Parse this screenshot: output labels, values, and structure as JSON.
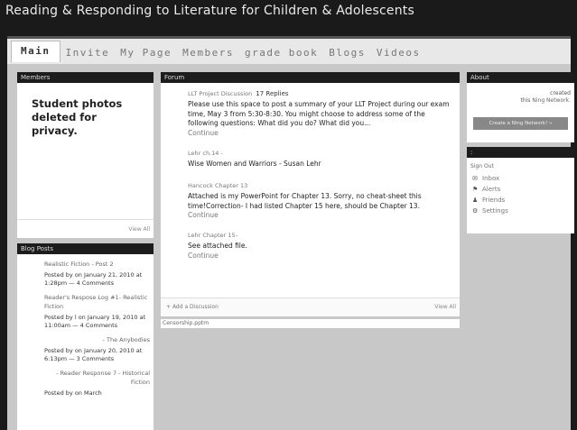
{
  "site": {
    "title": "Reading & Responding to Literature for Children & Adolescents"
  },
  "nav": {
    "tabs": [
      {
        "label": "Main",
        "active": true
      },
      {
        "label": "Invite"
      },
      {
        "label": "My Page"
      },
      {
        "label": "Members"
      },
      {
        "label": "grade book"
      },
      {
        "label": "Blogs"
      },
      {
        "label": "Videos"
      }
    ]
  },
  "members": {
    "header": "Members",
    "note": "Student photos deleted for privacy.",
    "view_all": "View All"
  },
  "blog_posts": {
    "header": "Blog Posts",
    "posts": [
      {
        "title": "Realistic Fiction - Post 2",
        "meta": "Posted by on January 21, 2010 at 1:28pm — 4 Comments"
      },
      {
        "title": "Reader's Respose Log #1- Realistic Fiction",
        "meta": "Posted by l on January 19, 2010 at 11:00am — 4 Comments"
      },
      {
        "title": "- The Anybodies",
        "meta": "Posted by on January 20, 2010 at 6:13pm — 3 Comments"
      },
      {
        "title": "- Reader Response 7 - Historical Fiction",
        "meta": "Posted by on March"
      }
    ]
  },
  "forum": {
    "header": "Forum",
    "topics": [
      {
        "title": "LLT Project Discussion",
        "replies": "17 Replies",
        "body": "Please use this space to post a summary of your LLT Project during our exam time, May 3 from 5:30-8:30. You might choose to address some of the following questions: What did you do? What did you...",
        "continue": "Continue"
      },
      {
        "title": "Lehr ch.14 -",
        "replies": "",
        "body": "Wise Women and Warriors - Susan Lehr",
        "continue": ""
      },
      {
        "title": "Hancock Chapter 13",
        "replies": "",
        "body": "Attached is my PowerPoint for Chapter 13. Sorry, no cheat-sheet this time!Correction- I had listed Chapter 15 here, should be Chapter 13.",
        "continue": "Continue"
      },
      {
        "title": "Lehr Chapter 15-",
        "replies": "",
        "body": "See attached file.",
        "continue": "Continue"
      }
    ],
    "add_discussion": "Add a Discussion",
    "view_all": "View All",
    "attachment": "Censorship.pptm"
  },
  "about": {
    "header": "About",
    "text_created": "created",
    "text_this": "this",
    "text_network_link": "Ning Network.",
    "button": "Create a Ning Network! »"
  },
  "userbox": {
    "header": ":",
    "sign_out": "Sign Out",
    "items": [
      {
        "icon": "envelope-icon",
        "glyph": "✉",
        "label": "Inbox"
      },
      {
        "icon": "alert-icon",
        "glyph": "⚑",
        "label": "Alerts"
      },
      {
        "icon": "person-icon",
        "glyph": "♟",
        "label": "Friends"
      },
      {
        "icon": "gear-icon",
        "glyph": "⚙",
        "label": "Settings"
      }
    ]
  }
}
